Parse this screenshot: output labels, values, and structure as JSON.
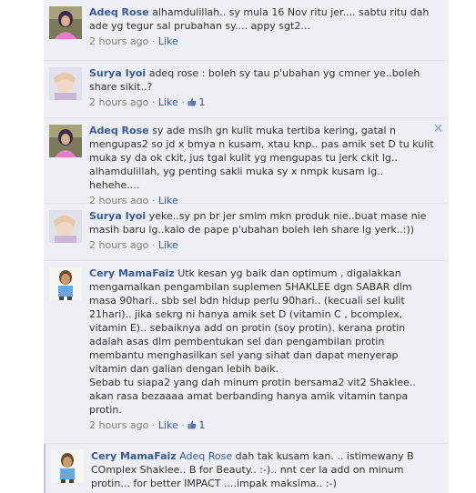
{
  "comments": [
    {
      "author": "Adeq Rose",
      "mention": "",
      "text": "alhamdulillah.. sy mula 16 Nov ritu jer.... sabtu ritu dah ade yg tegur sal prubahan sy.... appy sgt2...",
      "time": "2 hours ago",
      "like_label": "Like",
      "likes": ""
    },
    {
      "author": "Surya Iyoi",
      "mention": "",
      "text": "adeq rose : boleh sy tau p'ubahan yg cmner ye..boleh share sikit..?",
      "time": "2 hours ago",
      "like_label": "Like",
      "likes": "1"
    },
    {
      "author": "Adeq Rose",
      "mention": "",
      "text": "sy ade mslh gn kulit muka tertiba kering, gatal n mengupas2 so jd x bmya n kusam, xtau knp.. pas amik set D tu kulit muka sy da ok ckit, jus tgal kulit yg mengupas tu jerk ckit lg.. alhamdulillah, yg penting sakli muka sy x nmpk kusam lg.. hehehe....",
      "time": "2 hours ago",
      "like_label": "Like",
      "likes": "",
      "close_icon": "×"
    },
    {
      "author": "Surya Iyoi",
      "mention": "",
      "text": "yeke..sy pn br jer smlm mkn produk nie..buat mase nie masih baru lg..kalo de pape p'ubahan boleh leh share lg yerk..:))",
      "time": "2 hours ago",
      "like_label": "Like",
      "likes": ""
    },
    {
      "author": "Cery MamaFaiz",
      "mention": "",
      "text": "Utk kesan yg baik dan optimum , digalakkan mengamalkan pengambilan suplemen SHAKLEE dgn SABAR dlm masa 90hari.. sbb sel bdn hidup perlu 90hari.. (kecuali sel kulit 21hari).. jika sekrg ni hanya amik set D (vitamin C , bcomplex, vitamin E).. sebaiknya add on protin (soy protin). kerana protin adalah asas dlm pembentukan sel dan pengambilan protin membantu menghasilkan sel yang sihat dan dapat menyerap vitamin dan galian dengan lebih baik.\nSebab tu siapa2 yang dah minum protin bersama2 vit2 Shaklee.. akan rasa bezaaaa amat berbanding hanya amik vitamin tanpa protin.",
      "time": "2 hours ago",
      "like_label": "Like",
      "likes": "1"
    },
    {
      "author": "Cery MamaFaiz",
      "mention": "Adeq Rose",
      "text": "dah tak kusam kan. .. istimewany B COmplex Shaklee.. B for Beauty.. :-).. nnt cer la add on minum protin... for better IMPACT ....impak maksima.. :-)",
      "time": "",
      "like_label": "",
      "likes": ""
    }
  ]
}
